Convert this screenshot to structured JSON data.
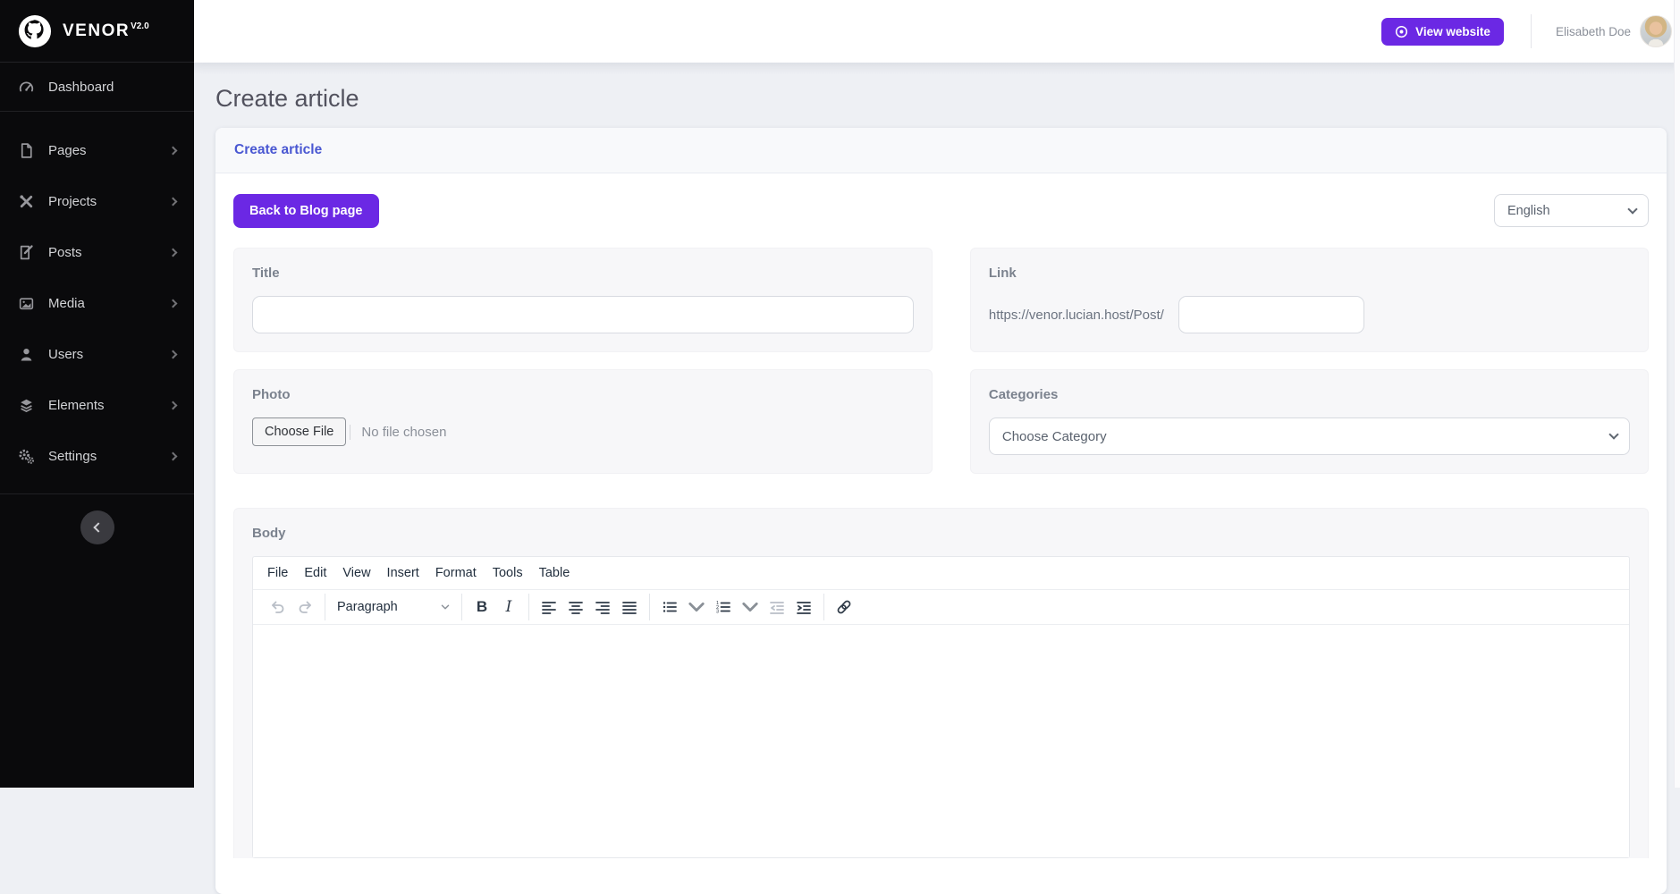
{
  "brand": {
    "name": "VENOR",
    "version": "V2.0"
  },
  "sidebar": {
    "items": [
      {
        "label": "Dashboard",
        "icon": "speedometer-icon"
      },
      {
        "label": "Pages",
        "icon": "page-icon"
      },
      {
        "label": "Projects",
        "icon": "tools-icon"
      },
      {
        "label": "Posts",
        "icon": "post-icon"
      },
      {
        "label": "Media",
        "icon": "media-icon"
      },
      {
        "label": "Users",
        "icon": "user-icon"
      },
      {
        "label": "Elements",
        "icon": "layers-icon"
      },
      {
        "label": "Settings",
        "icon": "gears-icon"
      }
    ]
  },
  "topbar": {
    "view_website_label": "View website",
    "user_name": "Elisabeth Doe"
  },
  "page": {
    "title": "Create article"
  },
  "panel": {
    "header": "Create article",
    "back_button": "Back to Blog page",
    "language": {
      "selected": "English"
    }
  },
  "form": {
    "title": {
      "label": "Title",
      "value": ""
    },
    "link": {
      "label": "Link",
      "prefix": "https://venor.lucian.host/Post/",
      "value": ""
    },
    "photo": {
      "label": "Photo",
      "button": "Choose File",
      "status": "No file chosen"
    },
    "categories": {
      "label": "Categories",
      "selected": "Choose Category"
    },
    "body": {
      "label": "Body"
    }
  },
  "editor": {
    "menu": [
      "File",
      "Edit",
      "View",
      "Insert",
      "Format",
      "Tools",
      "Table"
    ],
    "block_format": "Paragraph",
    "content": ""
  },
  "colors": {
    "accent_purple": "#6b28e4",
    "header_link_blue": "#4a58d2",
    "sidebar_bg": "#0a0a0c"
  }
}
